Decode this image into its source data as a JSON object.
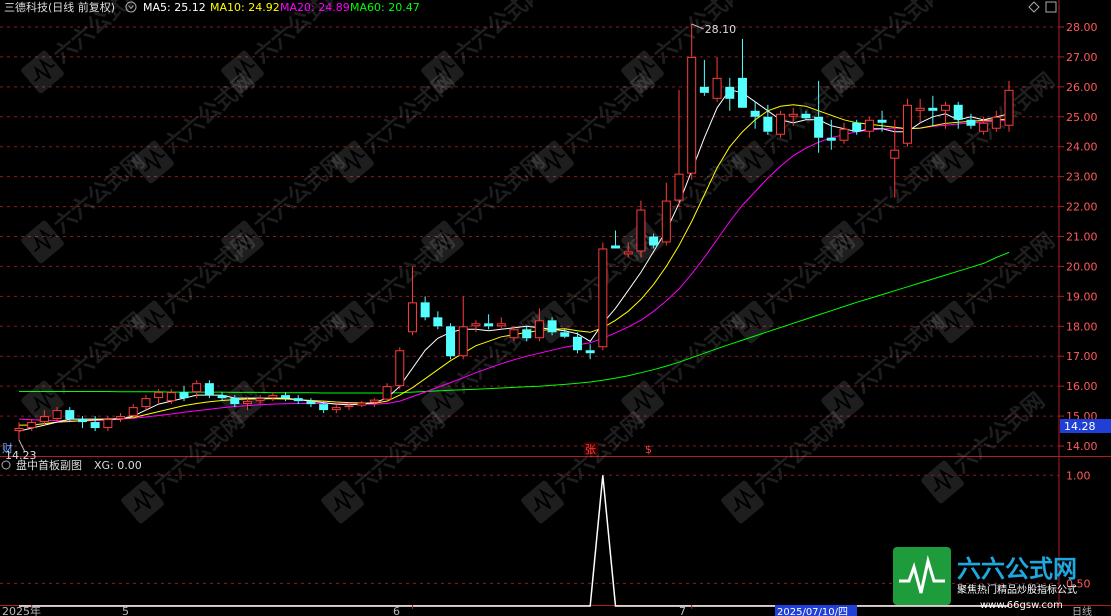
{
  "header": {
    "title": "三德科技(日线 前复权)",
    "ma5": "MA5: 25.12",
    "ma10": "MA10: 24.92",
    "ma20": "MA20: 24.89",
    "ma60": "MA60: 20.47",
    "colors": {
      "ma5": "#ffffff",
      "ma10": "#ffff00",
      "ma20": "#ff00ff",
      "ma60": "#00ff00"
    }
  },
  "sub_header": {
    "title": "盘中首板副图",
    "xg": "XG: 0.00"
  },
  "labels": {
    "high_marker": "28.10",
    "low_marker": "14.23",
    "last_price": "14.28",
    "cai": "财",
    "zhang": "张",
    "s": "$",
    "date_tag": "2025/07/10/四",
    "bottom_right": "日线",
    "axis_start": "2025年"
  },
  "watermark": {
    "brand": "六六公式网",
    "slogan": "聚焦热门精品炒股指标公式",
    "url": "www.66gsw.com"
  },
  "chart_data": [
    {
      "type": "candlestick",
      "title": "三德科技(日线 前复权)",
      "ylim": [
        13.7,
        28.3
      ],
      "yticks": [
        14.0,
        15.0,
        16.0,
        17.0,
        18.0,
        19.0,
        20.0,
        21.0,
        22.0,
        23.0,
        24.0,
        25.0,
        26.0,
        27.0,
        28.0
      ],
      "xticks": [
        "2025年",
        "5",
        "6",
        "7"
      ],
      "candles": [
        {
          "o": 14.5,
          "h": 14.8,
          "l": 14.2,
          "c": 14.6
        },
        {
          "o": 14.6,
          "h": 14.9,
          "l": 14.5,
          "c": 14.8
        },
        {
          "o": 14.8,
          "h": 15.2,
          "l": 14.7,
          "c": 15.0
        },
        {
          "o": 14.9,
          "h": 15.3,
          "l": 14.8,
          "c": 15.2
        },
        {
          "o": 15.2,
          "h": 15.3,
          "l": 14.8,
          "c": 14.9
        },
        {
          "o": 14.9,
          "h": 15.0,
          "l": 14.6,
          "c": 14.8
        },
        {
          "o": 14.8,
          "h": 15.0,
          "l": 14.5,
          "c": 14.6
        },
        {
          "o": 14.6,
          "h": 15.0,
          "l": 14.5,
          "c": 14.9
        },
        {
          "o": 14.9,
          "h": 15.1,
          "l": 14.8,
          "c": 15.0
        },
        {
          "o": 15.0,
          "h": 15.4,
          "l": 14.9,
          "c": 15.3
        },
        {
          "o": 15.3,
          "h": 15.7,
          "l": 15.2,
          "c": 15.6
        },
        {
          "o": 15.6,
          "h": 15.9,
          "l": 15.4,
          "c": 15.8
        },
        {
          "o": 15.5,
          "h": 15.9,
          "l": 15.4,
          "c": 15.8
        },
        {
          "o": 15.8,
          "h": 16.0,
          "l": 15.5,
          "c": 15.6
        },
        {
          "o": 15.8,
          "h": 16.2,
          "l": 15.6,
          "c": 16.1
        },
        {
          "o": 16.1,
          "h": 16.2,
          "l": 15.6,
          "c": 15.7
        },
        {
          "o": 15.7,
          "h": 15.8,
          "l": 15.5,
          "c": 15.6
        },
        {
          "o": 15.6,
          "h": 15.7,
          "l": 15.3,
          "c": 15.4
        },
        {
          "o": 15.4,
          "h": 15.6,
          "l": 15.2,
          "c": 15.5
        },
        {
          "o": 15.5,
          "h": 15.7,
          "l": 15.4,
          "c": 15.6
        },
        {
          "o": 15.6,
          "h": 15.8,
          "l": 15.5,
          "c": 15.7
        },
        {
          "o": 15.7,
          "h": 15.8,
          "l": 15.5,
          "c": 15.6
        },
        {
          "o": 15.6,
          "h": 15.7,
          "l": 15.4,
          "c": 15.5
        },
        {
          "o": 15.5,
          "h": 15.6,
          "l": 15.3,
          "c": 15.4
        },
        {
          "o": 15.4,
          "h": 15.5,
          "l": 15.1,
          "c": 15.2
        },
        {
          "o": 15.2,
          "h": 15.4,
          "l": 15.1,
          "c": 15.3
        },
        {
          "o": 15.3,
          "h": 15.4,
          "l": 15.2,
          "c": 15.35
        },
        {
          "o": 15.35,
          "h": 15.5,
          "l": 15.3,
          "c": 15.45
        },
        {
          "o": 15.45,
          "h": 15.6,
          "l": 15.3,
          "c": 15.55
        },
        {
          "o": 15.55,
          "h": 16.1,
          "l": 15.5,
          "c": 16.0
        },
        {
          "o": 16.0,
          "h": 17.3,
          "l": 15.9,
          "c": 17.2
        },
        {
          "o": 17.8,
          "h": 20.0,
          "l": 17.7,
          "c": 18.8
        },
        {
          "o": 18.8,
          "h": 19.0,
          "l": 18.2,
          "c": 18.3
        },
        {
          "o": 18.3,
          "h": 18.5,
          "l": 17.9,
          "c": 18.0
        },
        {
          "o": 18.0,
          "h": 18.1,
          "l": 16.9,
          "c": 17.0
        },
        {
          "o": 17.0,
          "h": 19.0,
          "l": 16.9,
          "c": 18.0
        },
        {
          "o": 18.0,
          "h": 18.2,
          "l": 17.8,
          "c": 18.1
        },
        {
          "o": 18.1,
          "h": 18.4,
          "l": 17.9,
          "c": 18.0
        },
        {
          "o": 18.0,
          "h": 18.3,
          "l": 17.9,
          "c": 18.1
        },
        {
          "o": 17.6,
          "h": 18.0,
          "l": 17.5,
          "c": 17.9
        },
        {
          "o": 17.9,
          "h": 18.0,
          "l": 17.5,
          "c": 17.6
        },
        {
          "o": 17.6,
          "h": 18.6,
          "l": 17.5,
          "c": 18.2
        },
        {
          "o": 18.2,
          "h": 18.3,
          "l": 17.7,
          "c": 17.8
        },
        {
          "o": 17.8,
          "h": 17.9,
          "l": 17.6,
          "c": 17.65
        },
        {
          "o": 17.65,
          "h": 17.8,
          "l": 17.1,
          "c": 17.2
        },
        {
          "o": 17.2,
          "h": 17.4,
          "l": 16.9,
          "c": 17.1
        },
        {
          "o": 17.3,
          "h": 20.8,
          "l": 17.2,
          "c": 20.6
        },
        {
          "o": 20.7,
          "h": 21.2,
          "l": 20.6,
          "c": 20.6
        },
        {
          "o": 20.4,
          "h": 20.8,
          "l": 20.3,
          "c": 20.5
        },
        {
          "o": 20.5,
          "h": 22.2,
          "l": 20.3,
          "c": 21.9
        },
        {
          "o": 21.0,
          "h": 21.1,
          "l": 20.6,
          "c": 20.7
        },
        {
          "o": 20.8,
          "h": 22.8,
          "l": 20.7,
          "c": 22.2
        },
        {
          "o": 22.2,
          "h": 25.9,
          "l": 22.0,
          "c": 23.1
        },
        {
          "o": 23.1,
          "h": 28.1,
          "l": 22.9,
          "c": 27.0
        },
        {
          "o": 26.0,
          "h": 26.9,
          "l": 25.7,
          "c": 25.8
        },
        {
          "o": 25.6,
          "h": 27.0,
          "l": 25.5,
          "c": 26.3
        },
        {
          "o": 26.0,
          "h": 26.3,
          "l": 25.2,
          "c": 25.6
        },
        {
          "o": 26.3,
          "h": 27.6,
          "l": 25.3,
          "c": 25.3
        },
        {
          "o": 25.2,
          "h": 25.5,
          "l": 24.6,
          "c": 25.0
        },
        {
          "o": 25.0,
          "h": 25.4,
          "l": 24.4,
          "c": 24.5
        },
        {
          "o": 24.4,
          "h": 25.2,
          "l": 24.3,
          "c": 25.1
        },
        {
          "o": 25.0,
          "h": 25.3,
          "l": 24.7,
          "c": 25.1
        },
        {
          "o": 25.1,
          "h": 25.2,
          "l": 24.9,
          "c": 24.95
        },
        {
          "o": 25.0,
          "h": 26.2,
          "l": 23.8,
          "c": 24.3
        },
        {
          "o": 24.3,
          "h": 24.9,
          "l": 23.9,
          "c": 24.2
        },
        {
          "o": 24.2,
          "h": 24.8,
          "l": 24.1,
          "c": 24.6
        },
        {
          "o": 24.8,
          "h": 24.9,
          "l": 24.4,
          "c": 24.5
        },
        {
          "o": 24.5,
          "h": 25.0,
          "l": 24.3,
          "c": 24.9
        },
        {
          "o": 24.9,
          "h": 25.2,
          "l": 24.5,
          "c": 24.8
        },
        {
          "o": 23.6,
          "h": 24.9,
          "l": 22.3,
          "c": 23.9
        },
        {
          "o": 24.1,
          "h": 25.6,
          "l": 24.0,
          "c": 25.4
        },
        {
          "o": 25.2,
          "h": 25.6,
          "l": 24.8,
          "c": 25.3
        },
        {
          "o": 25.3,
          "h": 25.7,
          "l": 24.7,
          "c": 25.2
        },
        {
          "o": 25.2,
          "h": 25.5,
          "l": 24.6,
          "c": 25.4
        },
        {
          "o": 25.4,
          "h": 25.5,
          "l": 24.6,
          "c": 24.9
        },
        {
          "o": 24.9,
          "h": 25.1,
          "l": 24.6,
          "c": 24.7
        },
        {
          "o": 24.5,
          "h": 25.0,
          "l": 24.4,
          "c": 24.8
        },
        {
          "o": 24.6,
          "h": 25.2,
          "l": 24.5,
          "c": 25.0
        },
        {
          "o": 24.7,
          "h": 26.2,
          "l": 24.5,
          "c": 25.9
        }
      ],
      "ma5": [
        14.5,
        14.6,
        14.7,
        14.8,
        14.9,
        14.9,
        14.9,
        14.9,
        14.9,
        15.0,
        15.2,
        15.4,
        15.5,
        15.6,
        15.7,
        15.7,
        15.7,
        15.6,
        15.6,
        15.6,
        15.6,
        15.6,
        15.55,
        15.5,
        15.45,
        15.4,
        15.38,
        15.4,
        15.45,
        15.6,
        16.0,
        16.6,
        17.2,
        17.6,
        17.8,
        17.9,
        17.9,
        17.85,
        17.9,
        17.95,
        18.0,
        17.95,
        17.9,
        17.85,
        17.75,
        17.5,
        18.1,
        18.6,
        19.2,
        19.8,
        20.5,
        21.2,
        22.1,
        23.2,
        24.3,
        25.3,
        25.9,
        25.8,
        25.5,
        25.2,
        24.9,
        24.8,
        24.9,
        24.9,
        24.7,
        24.6,
        24.5,
        24.6,
        24.6,
        24.5,
        24.5,
        24.8,
        25.0,
        25.1,
        24.9,
        25.0,
        24.9,
        25.0,
        25.1
      ],
      "ma10": [
        14.7,
        14.7,
        14.75,
        14.8,
        14.82,
        14.85,
        14.87,
        14.9,
        14.92,
        14.95,
        15.05,
        15.15,
        15.25,
        15.35,
        15.42,
        15.48,
        15.52,
        15.55,
        15.57,
        15.58,
        15.58,
        15.57,
        15.55,
        15.52,
        15.5,
        15.47,
        15.45,
        15.44,
        15.43,
        15.5,
        15.7,
        15.95,
        16.25,
        16.55,
        16.85,
        17.1,
        17.35,
        17.5,
        17.65,
        17.72,
        17.8,
        17.85,
        17.9,
        17.92,
        17.85,
        17.8,
        17.95,
        18.2,
        18.5,
        18.9,
        19.4,
        20.0,
        20.7,
        21.5,
        22.4,
        23.3,
        24.0,
        24.5,
        24.9,
        25.2,
        25.35,
        25.4,
        25.35,
        25.2,
        25.05,
        24.9,
        24.8,
        24.75,
        24.7,
        24.65,
        24.6,
        24.62,
        24.7,
        24.78,
        24.82,
        24.85,
        24.88,
        24.9,
        24.92
      ],
      "ma20": [
        14.9,
        14.88,
        14.86,
        14.85,
        14.84,
        14.84,
        14.85,
        14.87,
        14.9,
        14.93,
        14.97,
        15.02,
        15.07,
        15.13,
        15.18,
        15.23,
        15.28,
        15.32,
        15.35,
        15.38,
        15.4,
        15.41,
        15.42,
        15.42,
        15.42,
        15.41,
        15.41,
        15.4,
        15.4,
        15.42,
        15.5,
        15.65,
        15.8,
        15.97,
        16.12,
        16.28,
        16.45,
        16.6,
        16.75,
        16.88,
        17.0,
        17.1,
        17.2,
        17.3,
        17.38,
        17.45,
        17.6,
        17.78,
        17.98,
        18.2,
        18.5,
        18.85,
        19.25,
        19.75,
        20.3,
        20.9,
        21.5,
        22.05,
        22.5,
        22.95,
        23.35,
        23.7,
        23.95,
        24.15,
        24.3,
        24.4,
        24.5,
        24.55,
        24.6,
        24.62,
        24.6,
        24.62,
        24.68,
        24.72,
        24.76,
        24.8,
        24.83,
        24.86,
        24.89
      ],
      "ma60": [
        15.82,
        15.82,
        15.82,
        15.82,
        15.82,
        15.82,
        15.82,
        15.82,
        15.81,
        15.81,
        15.81,
        15.81,
        15.8,
        15.8,
        15.8,
        15.8,
        15.8,
        15.79,
        15.79,
        15.79,
        15.78,
        15.78,
        15.78,
        15.78,
        15.77,
        15.77,
        15.77,
        15.77,
        15.77,
        15.77,
        15.78,
        15.8,
        15.82,
        15.84,
        15.86,
        15.88,
        15.9,
        15.92,
        15.94,
        15.96,
        15.98,
        16.0,
        16.03,
        16.06,
        16.1,
        16.14,
        16.2,
        16.27,
        16.35,
        16.45,
        16.55,
        16.67,
        16.8,
        16.95,
        17.1,
        17.25,
        17.4,
        17.54,
        17.68,
        17.82,
        17.96,
        18.1,
        18.24,
        18.38,
        18.52,
        18.66,
        18.8,
        18.93,
        19.06,
        19.19,
        19.32,
        19.45,
        19.58,
        19.71,
        19.84,
        19.97,
        20.1,
        20.3,
        20.47
      ]
    },
    {
      "type": "line",
      "title": "盘中首板副图",
      "ylim": [
        0.4,
        1.08
      ],
      "yticks": [
        0.5,
        1.0
      ],
      "series": [
        {
          "name": "XG",
          "values": [
            0,
            0,
            0,
            0,
            0,
            0,
            0,
            0,
            0,
            0,
            0,
            0,
            0,
            0,
            0,
            0,
            0,
            0,
            0,
            0,
            0,
            0,
            0,
            0,
            0,
            0,
            0,
            0,
            0,
            0,
            0,
            0,
            0,
            0,
            0,
            0,
            0,
            0,
            0,
            0,
            0,
            0,
            0,
            0,
            0,
            0,
            1,
            0,
            0,
            0,
            0,
            0,
            0,
            0,
            0,
            0,
            0,
            0,
            0,
            0,
            0,
            0,
            0,
            0,
            0,
            0,
            0,
            0,
            0,
            0,
            0,
            0,
            0,
            0,
            0,
            0,
            0,
            0,
            0
          ]
        }
      ]
    }
  ]
}
